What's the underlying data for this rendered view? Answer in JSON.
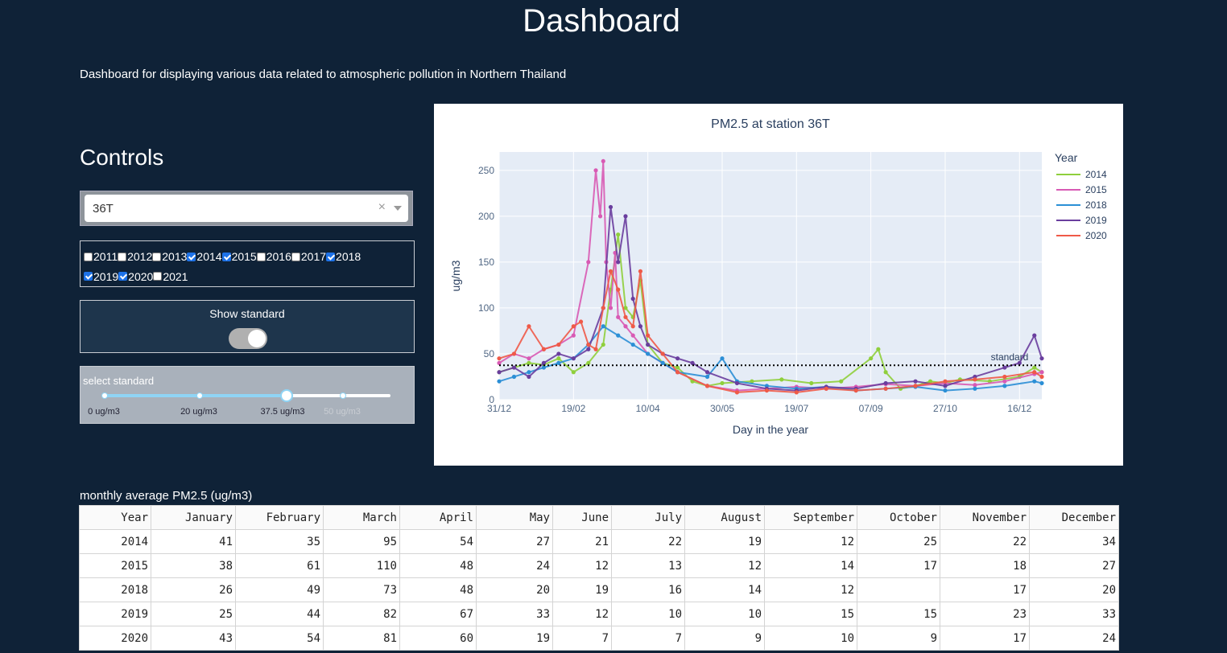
{
  "page": {
    "title": "Dashboard",
    "subtitle": "Dashboard for displaying various data related to atmospheric pollution in Northern Thailand"
  },
  "controls": {
    "heading": "Controls",
    "station": {
      "value": "36T",
      "clear": "×"
    },
    "years": [
      {
        "label": "2011",
        "checked": false
      },
      {
        "label": "2012",
        "checked": false
      },
      {
        "label": "2013",
        "checked": false
      },
      {
        "label": "2014",
        "checked": true
      },
      {
        "label": "2015",
        "checked": true
      },
      {
        "label": "2016",
        "checked": false
      },
      {
        "label": "2017",
        "checked": false
      },
      {
        "label": "2018",
        "checked": true
      },
      {
        "label": "2019",
        "checked": true
      },
      {
        "label": "2020",
        "checked": true
      },
      {
        "label": "2021",
        "checked": false
      }
    ],
    "show_standard": {
      "label": "Show standard",
      "on": true
    },
    "standard_slider": {
      "label": "select standard",
      "marks": [
        "0 ug/m3",
        "20 ug/m3",
        "37.5 ug/m3",
        "50 ug/m3"
      ],
      "selected_index": 2
    }
  },
  "chart_data": {
    "type": "line",
    "title": "PM2.5 at station 36T",
    "xlabel": "Day in the year",
    "ylabel": "ug/m3",
    "x_ticks": [
      "31/12",
      "19/02",
      "10/04",
      "30/05",
      "19/07",
      "07/09",
      "27/10",
      "16/12"
    ],
    "y_ticks": [
      0,
      50,
      100,
      150,
      200,
      250
    ],
    "xlim": [
      0,
      365
    ],
    "ylim": [
      0,
      270
    ],
    "legend_title": "Year",
    "legend_position": "right",
    "standard": {
      "value": 37.5,
      "label": "standard"
    },
    "series": [
      {
        "name": "2014",
        "color": "#8fcf3c",
        "x": [
          0,
          10,
          20,
          30,
          40,
          50,
          60,
          70,
          75,
          80,
          85,
          90,
          95,
          100,
          110,
          120,
          130,
          140,
          150,
          170,
          190,
          210,
          230,
          250,
          255,
          260,
          270,
          280,
          290,
          300,
          310,
          330,
          350,
          360,
          365
        ],
        "y": [
          30,
          35,
          40,
          38,
          45,
          30,
          40,
          60,
          120,
          180,
          100,
          90,
          130,
          60,
          40,
          35,
          20,
          15,
          18,
          20,
          22,
          18,
          20,
          45,
          55,
          30,
          12,
          15,
          20,
          18,
          22,
          20,
          25,
          35,
          30
        ]
      },
      {
        "name": "2015",
        "color": "#d85ab4",
        "x": [
          0,
          10,
          20,
          30,
          40,
          50,
          60,
          65,
          68,
          70,
          72,
          75,
          78,
          80,
          85,
          90,
          100,
          110,
          120,
          140,
          160,
          180,
          200,
          220,
          240,
          260,
          280,
          300,
          320,
          340,
          360,
          365
        ],
        "y": [
          40,
          50,
          45,
          55,
          60,
          70,
          150,
          250,
          200,
          260,
          150,
          100,
          160,
          90,
          80,
          70,
          50,
          40,
          30,
          15,
          10,
          12,
          14,
          12,
          14,
          17,
          15,
          18,
          16,
          20,
          28,
          30
        ]
      },
      {
        "name": "2018",
        "color": "#2b8fd6",
        "x": [
          0,
          10,
          20,
          30,
          40,
          50,
          60,
          70,
          80,
          90,
          100,
          110,
          120,
          140,
          150,
          160,
          180,
          200,
          220,
          240,
          260,
          280,
          300,
          320,
          340,
          360,
          365
        ],
        "y": [
          20,
          25,
          30,
          35,
          40,
          45,
          60,
          80,
          70,
          60,
          50,
          40,
          30,
          25,
          45,
          20,
          15,
          12,
          14,
          10,
          12,
          14,
          10,
          12,
          15,
          20,
          18
        ]
      },
      {
        "name": "2019",
        "color": "#6a3e9e",
        "x": [
          0,
          10,
          20,
          30,
          40,
          50,
          60,
          70,
          75,
          80,
          85,
          90,
          95,
          100,
          110,
          120,
          130,
          140,
          160,
          180,
          200,
          220,
          240,
          260,
          280,
          300,
          320,
          340,
          350,
          360,
          365
        ],
        "y": [
          30,
          35,
          25,
          40,
          50,
          45,
          55,
          100,
          210,
          150,
          200,
          110,
          80,
          60,
          50,
          45,
          40,
          30,
          18,
          12,
          10,
          14,
          12,
          18,
          20,
          15,
          25,
          35,
          40,
          70,
          45
        ]
      },
      {
        "name": "2020",
        "color": "#ef5a48",
        "x": [
          0,
          10,
          20,
          30,
          40,
          50,
          55,
          60,
          65,
          70,
          75,
          80,
          85,
          90,
          95,
          100,
          110,
          120,
          140,
          160,
          180,
          200,
          220,
          240,
          260,
          280,
          300,
          320,
          340,
          360,
          365
        ],
        "y": [
          45,
          50,
          80,
          55,
          60,
          80,
          85,
          60,
          55,
          100,
          140,
          120,
          90,
          80,
          140,
          70,
          50,
          30,
          15,
          8,
          10,
          8,
          12,
          10,
          12,
          15,
          20,
          22,
          25,
          30,
          25
        ]
      }
    ]
  },
  "table": {
    "title": "monthly average PM2.5 (ug/m3)",
    "columns": [
      "Year",
      "January",
      "February",
      "March",
      "April",
      "May",
      "June",
      "July",
      "August",
      "September",
      "October",
      "November",
      "December"
    ],
    "rows": [
      [
        "2014",
        "41",
        "35",
        "95",
        "54",
        "27",
        "21",
        "22",
        "19",
        "12",
        "25",
        "22",
        "34"
      ],
      [
        "2015",
        "38",
        "61",
        "110",
        "48",
        "24",
        "12",
        "13",
        "12",
        "14",
        "17",
        "18",
        "27"
      ],
      [
        "2018",
        "26",
        "49",
        "73",
        "48",
        "20",
        "19",
        "16",
        "14",
        "12",
        "",
        "17",
        "20"
      ],
      [
        "2019",
        "25",
        "44",
        "82",
        "67",
        "33",
        "12",
        "10",
        "10",
        "15",
        "15",
        "23",
        "33"
      ],
      [
        "2020",
        "43",
        "54",
        "81",
        "60",
        "19",
        "7",
        "7",
        "9",
        "10",
        "9",
        "17",
        "24"
      ]
    ]
  }
}
